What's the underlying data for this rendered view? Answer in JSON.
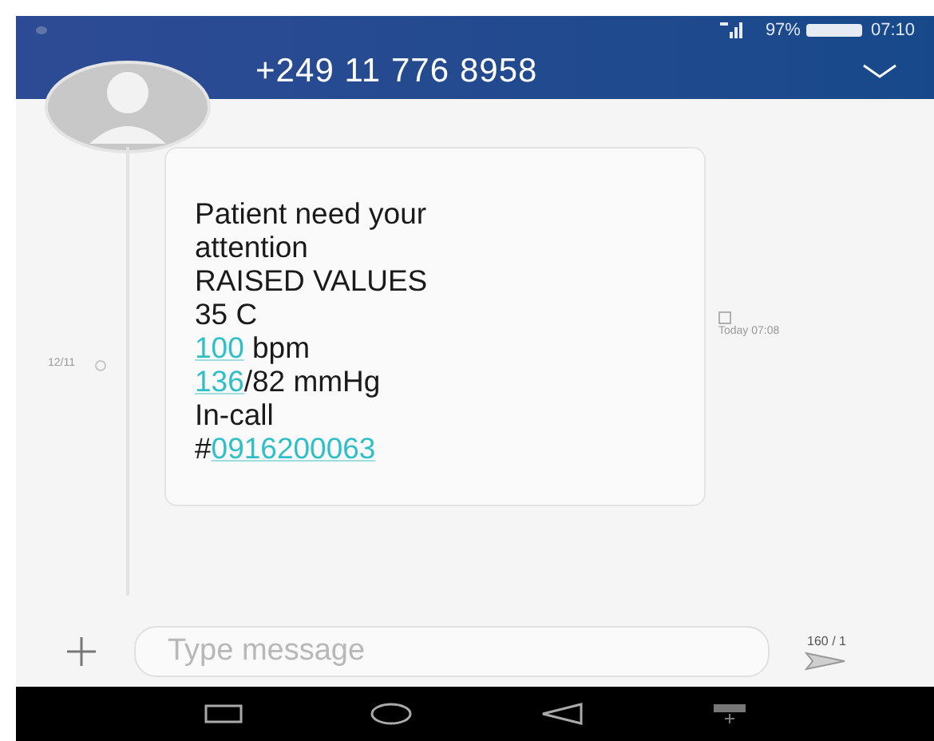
{
  "status_bar": {
    "battery": "97%",
    "time": "07:10"
  },
  "header": {
    "title": "+249 11 776 8958"
  },
  "thread": {
    "date": "12/11",
    "message": {
      "lines": [
        [
          {
            "text": "Patient need your",
            "link": false
          }
        ],
        [
          {
            "text": "attention",
            "link": false
          }
        ],
        [
          {
            "text": "RAISED VALUES",
            "link": false
          }
        ],
        [
          {
            "text": "35 C",
            "link": false
          }
        ],
        [
          {
            "text": "100",
            "link": true
          },
          {
            "text": " bpm",
            "link": false
          }
        ],
        [
          {
            "text": "136",
            "link": true
          },
          {
            "text": "/82 mmHg",
            "link": false
          }
        ],
        [
          {
            "text": "In-call",
            "link": false
          }
        ],
        [
          {
            "text": "#",
            "link": false
          },
          {
            "text": "0916200063",
            "link": true
          }
        ]
      ],
      "time": "Today 07:08"
    }
  },
  "composer": {
    "placeholder": "Type message",
    "counter": "160 / 1"
  }
}
